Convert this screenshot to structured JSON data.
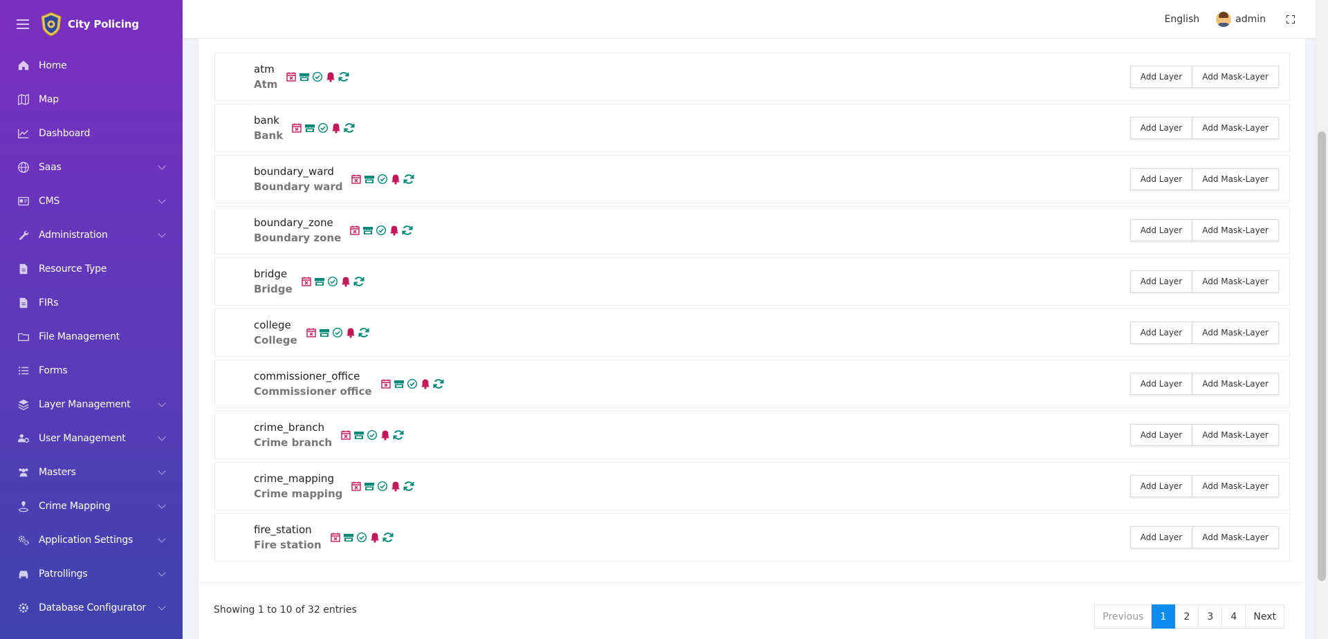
{
  "app": {
    "title": "City Policing"
  },
  "sidebar": {
    "items": [
      {
        "label": "Home",
        "icon": "home-icon",
        "has_children": false
      },
      {
        "label": "Map",
        "icon": "map-icon",
        "has_children": false
      },
      {
        "label": "Dashboard",
        "icon": "chart-line-icon",
        "has_children": false
      },
      {
        "label": "Saas",
        "icon": "globe-icon",
        "has_children": true
      },
      {
        "label": "CMS",
        "icon": "id-card-icon",
        "has_children": true
      },
      {
        "label": "Administration",
        "icon": "wrench-icon",
        "has_children": true
      },
      {
        "label": "Resource Type",
        "icon": "file-icon",
        "has_children": false
      },
      {
        "label": "FIRs",
        "icon": "file-icon",
        "has_children": false
      },
      {
        "label": "File Management",
        "icon": "folder-icon",
        "has_children": false
      },
      {
        "label": "Forms",
        "icon": "list-icon",
        "has_children": false
      },
      {
        "label": "Layer Management",
        "icon": "layers-icon",
        "has_children": true
      },
      {
        "label": "User Management",
        "icon": "users-cog-icon",
        "has_children": true
      },
      {
        "label": "Masters",
        "icon": "users-icon",
        "has_children": true
      },
      {
        "label": "Crime Mapping",
        "icon": "map-pin-icon",
        "has_children": true
      },
      {
        "label": "Application Settings",
        "icon": "cogs-icon",
        "has_children": true
      },
      {
        "label": "Patrollings",
        "icon": "car-icon",
        "has_children": true
      },
      {
        "label": "Database Configurator",
        "icon": "gear-icon",
        "has_children": true
      }
    ]
  },
  "header": {
    "language": "English",
    "user": "admin"
  },
  "layers": [
    {
      "key": "atm",
      "title": "Atm"
    },
    {
      "key": "bank",
      "title": "Bank"
    },
    {
      "key": "boundary_ward",
      "title": "Boundary ward"
    },
    {
      "key": "boundary_zone",
      "title": "Boundary zone"
    },
    {
      "key": "bridge",
      "title": "Bridge"
    },
    {
      "key": "college",
      "title": "College"
    },
    {
      "key": "commissioner_office",
      "title": "Commissioner office"
    },
    {
      "key": "crime_branch",
      "title": "Crime branch"
    },
    {
      "key": "crime_mapping",
      "title": "Crime mapping"
    },
    {
      "key": "fire_station",
      "title": "Fire station"
    }
  ],
  "row_actions": {
    "add_layer": "Add Layer",
    "add_mask_layer": "Add Mask-Layer"
  },
  "row_icon_colors": {
    "calendar": "#c2185b",
    "store": "#00897b",
    "check": "#00897b",
    "bell": "#c2185b",
    "sync": "#00897b"
  },
  "table_info": "Showing 1 to 10 of 32 entries",
  "pagination": {
    "previous": "Previous",
    "pages": [
      "1",
      "2",
      "3",
      "4"
    ],
    "active_page": "1",
    "next": "Next"
  },
  "colors": {
    "sidebar_top": "#7b2fbf",
    "sidebar_bottom": "#3f43ae",
    "accent": "#0d8cf0"
  }
}
